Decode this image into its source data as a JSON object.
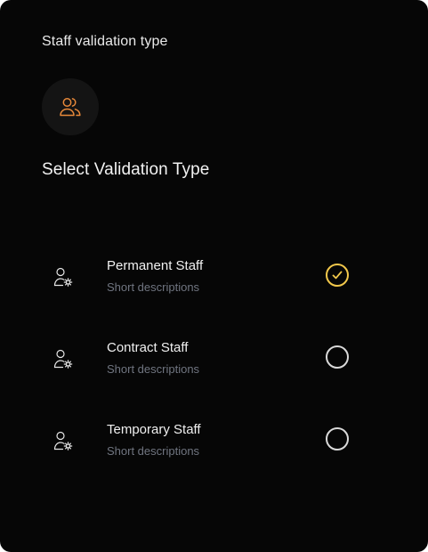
{
  "header": {
    "title": "Staff validation type",
    "icon": "users-icon",
    "accent_color": "#e8893a"
  },
  "section": {
    "title": "Select Validation Type"
  },
  "options": [
    {
      "label": "Permanent Staff",
      "description": "Short descriptions",
      "icon": "user-settings-icon",
      "selected": true
    },
    {
      "label": "Contract Staff",
      "description": "Short descriptions",
      "icon": "user-settings-icon",
      "selected": false
    },
    {
      "label": "Temporary Staff",
      "description": "Short descriptions",
      "icon": "user-settings-icon",
      "selected": false
    }
  ],
  "colors": {
    "background": "#060606",
    "selected": "#f2c84b",
    "unselected": "#d9d9d9",
    "muted_text": "#707580"
  }
}
